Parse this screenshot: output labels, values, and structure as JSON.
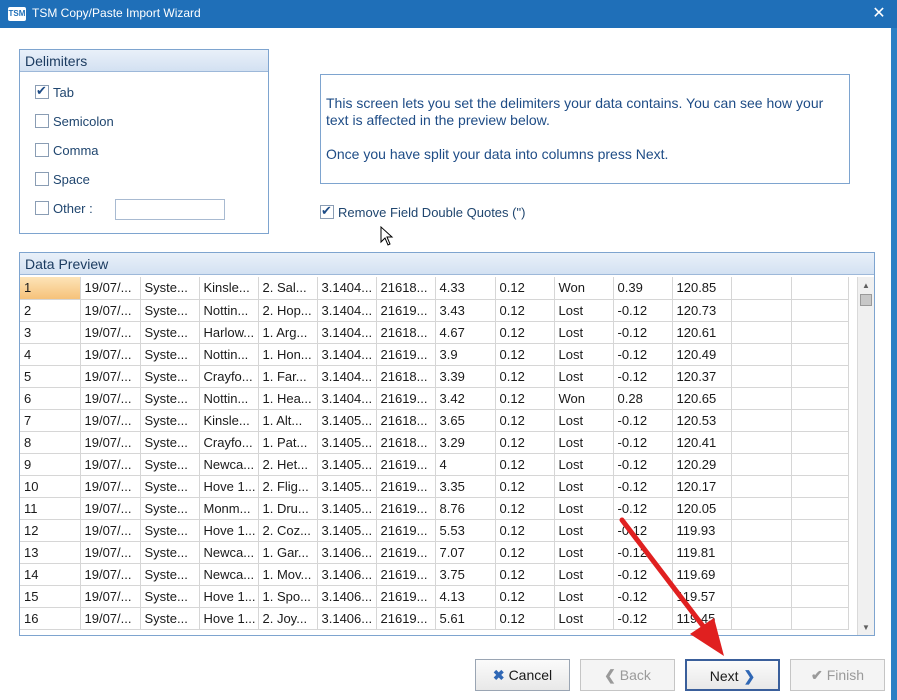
{
  "window": {
    "app_icon": "TSM",
    "title": "TSM Copy/Paste Import Wizard",
    "close_glyph": "✕"
  },
  "delimiters": {
    "heading": "Delimiters",
    "options": [
      {
        "label": "Tab",
        "checked": true
      },
      {
        "label": "Semicolon",
        "checked": false
      },
      {
        "label": "Comma",
        "checked": false
      },
      {
        "label": "Space",
        "checked": false
      },
      {
        "label": "Other :",
        "checked": false
      }
    ],
    "other_value": ""
  },
  "info": {
    "line1": "This screen lets you set the delimiters your data contains. You can see how your text is affected in the preview below.",
    "line2": "Once you have split your data into columns press Next."
  },
  "remove_quotes": {
    "label": "Remove Field Double Quotes (\")",
    "checked": true
  },
  "preview": {
    "heading": "Data Preview",
    "rows": [
      [
        "1",
        "19/07/...",
        "Syste...",
        "Kinsle...",
        "2. Sal...",
        "3.1404...",
        "21618...",
        "4.33",
        "0.12",
        "Won",
        "0.39",
        "120.85"
      ],
      [
        "2",
        "19/07/...",
        "Syste...",
        "Nottin...",
        "2. Hop...",
        "3.1404...",
        "21619...",
        "3.43",
        "0.12",
        "Lost",
        "-0.12",
        "120.73"
      ],
      [
        "3",
        "19/07/...",
        "Syste...",
        "Harlow...",
        "1. Arg...",
        "3.1404...",
        "21618...",
        "4.67",
        "0.12",
        "Lost",
        "-0.12",
        "120.61"
      ],
      [
        "4",
        "19/07/...",
        "Syste...",
        "Nottin...",
        "1. Hon...",
        "3.1404...",
        "21619...",
        "3.9",
        "0.12",
        "Lost",
        "-0.12",
        "120.49"
      ],
      [
        "5",
        "19/07/...",
        "Syste...",
        "Crayfo...",
        "1. Far...",
        "3.1404...",
        "21618...",
        "3.39",
        "0.12",
        "Lost",
        "-0.12",
        "120.37"
      ],
      [
        "6",
        "19/07/...",
        "Syste...",
        "Nottin...",
        "1. Hea...",
        "3.1404...",
        "21619...",
        "3.42",
        "0.12",
        "Won",
        "0.28",
        "120.65"
      ],
      [
        "7",
        "19/07/...",
        "Syste...",
        "Kinsle...",
        "1. Alt...",
        "3.1405...",
        "21618...",
        "3.65",
        "0.12",
        "Lost",
        "-0.12",
        "120.53"
      ],
      [
        "8",
        "19/07/...",
        "Syste...",
        "Crayfo...",
        "1. Pat...",
        "3.1405...",
        "21618...",
        "3.29",
        "0.12",
        "Lost",
        "-0.12",
        "120.41"
      ],
      [
        "9",
        "19/07/...",
        "Syste...",
        "Newca...",
        "2. Het...",
        "3.1405...",
        "21619...",
        "4",
        "0.12",
        "Lost",
        "-0.12",
        "120.29"
      ],
      [
        "10",
        "19/07/...",
        "Syste...",
        "Hove 1...",
        "2. Flig...",
        "3.1405...",
        "21619...",
        "3.35",
        "0.12",
        "Lost",
        "-0.12",
        "120.17"
      ],
      [
        "11",
        "19/07/...",
        "Syste...",
        "Monm...",
        "1. Dru...",
        "3.1405...",
        "21619...",
        "8.76",
        "0.12",
        "Lost",
        "-0.12",
        "120.05"
      ],
      [
        "12",
        "19/07/...",
        "Syste...",
        "Hove 1...",
        "2. Coz...",
        "3.1405...",
        "21619...",
        "5.53",
        "0.12",
        "Lost",
        "-0.12",
        "119.93"
      ],
      [
        "13",
        "19/07/...",
        "Syste...",
        "Newca...",
        "1. Gar...",
        "3.1406...",
        "21619...",
        "7.07",
        "0.12",
        "Lost",
        "-0.12",
        "119.81"
      ],
      [
        "14",
        "19/07/...",
        "Syste...",
        "Newca...",
        "1. Mov...",
        "3.1406...",
        "21619...",
        "3.75",
        "0.12",
        "Lost",
        "-0.12",
        "119.69"
      ],
      [
        "15",
        "19/07/...",
        "Syste...",
        "Hove 1...",
        "1. Spo...",
        "3.1406...",
        "21619...",
        "4.13",
        "0.12",
        "Lost",
        "-0.12",
        "119.57"
      ],
      [
        "16",
        "19/07/...",
        "Syste...",
        "Hove 1...",
        "2. Joy...",
        "3.1406...",
        "21619...",
        "5.61",
        "0.12",
        "Lost",
        "-0.12",
        "119.45"
      ]
    ]
  },
  "buttons": {
    "cancel": {
      "label": "Cancel",
      "icon": "✖"
    },
    "back": {
      "label": "Back",
      "icon": "❮"
    },
    "next": {
      "label": "Next",
      "icon": "❯"
    },
    "finish": {
      "label": "Finish",
      "icon": "✔"
    }
  },
  "colors": {
    "accent": "#1f6fb8",
    "annotation_arrow": "#e02020"
  }
}
